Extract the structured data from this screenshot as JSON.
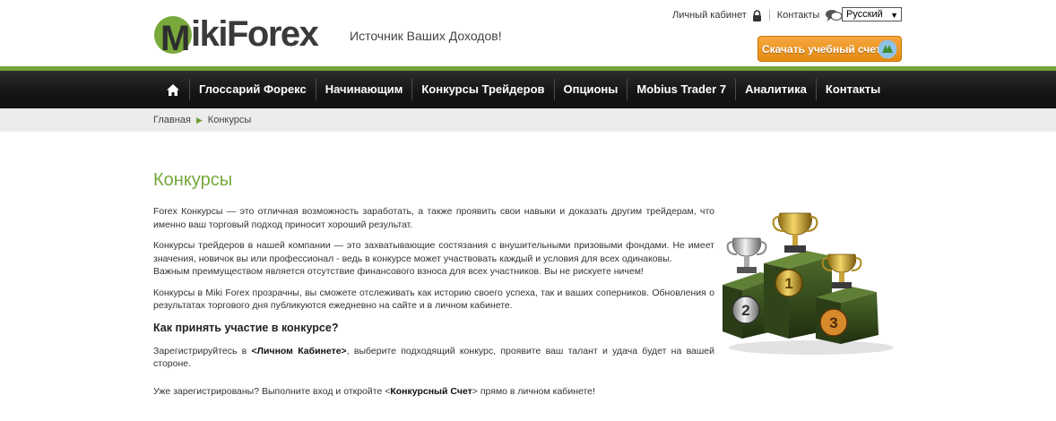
{
  "header": {
    "logo_text": "ikiForex",
    "logo_letter": "M",
    "tagline": "Источник Ваших Доходов!",
    "top_links": {
      "cabinet": "Личный кабинет",
      "contacts": "Контакты"
    },
    "language": "Русский",
    "download_button": "Скачать учебный счет"
  },
  "nav": {
    "items": [
      {
        "label": "Глоссарий Форекс"
      },
      {
        "label": "Начинающим"
      },
      {
        "label": "Конкурсы Трейдеров"
      },
      {
        "label": "Опционы"
      },
      {
        "label": "Mobius Trader 7"
      },
      {
        "label": "Аналитика"
      },
      {
        "label": "Контакты"
      }
    ]
  },
  "breadcrumb": {
    "home": "Главная",
    "current": "Конкурсы"
  },
  "main": {
    "title": "Конкурсы",
    "p1": "Forex Конкурсы  — это отличная возможность заработать, а также проявить свои навыки и доказать другим трейдерам, что именно ваш торговый подход приносит хороший результат.",
    "p2a": "Конкурсы трейдеров в нашей компании — это захватывающие состязания с внушительными призовыми фондами. Не имеет значения, новичок вы или профессионал - ведь в конкурсе может участвовать каждый и условия для всех одинаковы.",
    "p2b": "Важным преимуществом является отсутствие финансового взноса для всех участников.  Вы не рискуете ничем!",
    "p3": "Конкурсы в Miki Forex прозрачны, вы сможете отслеживать как историю своего успеха, так и ваших соперников. Обновления о результатах торгового дня публикуются ежедневно на сайте и в личном кабинете.",
    "subtitle": "Как принять участие в конкурсе?",
    "p4_pre": "Зарегистрируйтесь в ",
    "p4_bold": "<Личном Кабинете>",
    "p4_post": ", выберите подходящий конкурс, проявите ваш талант и удача будет на вашей стороне.",
    "p5_pre": "Уже зарегистрированы? Выполните вход и откройте <",
    "p5_bold": "Конкурсный Счет",
    "p5_post": "> прямо в личном кабинете!"
  },
  "podium": {
    "places": [
      "1",
      "2",
      "3"
    ]
  }
}
